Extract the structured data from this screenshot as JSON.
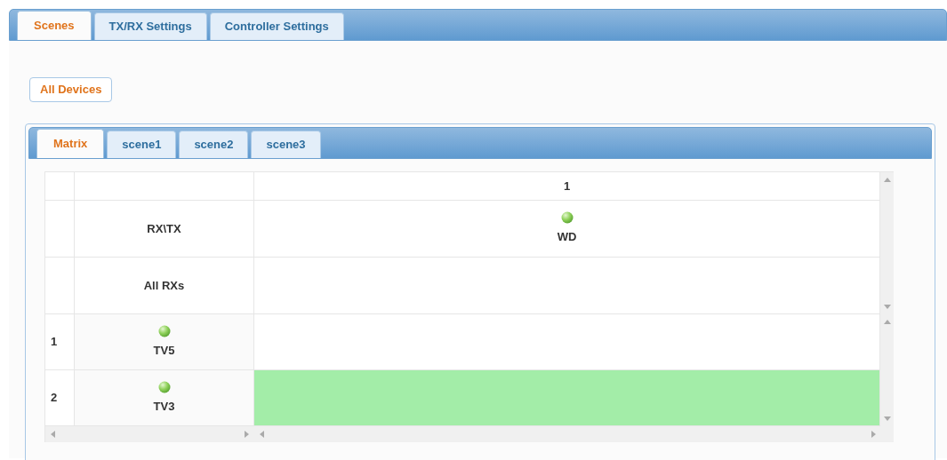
{
  "main_tabs": [
    {
      "label": "Scenes",
      "selected": true
    },
    {
      "label": "TX/RX Settings",
      "selected": false
    },
    {
      "label": "Controller Settings",
      "selected": false
    }
  ],
  "all_devices_button": "All Devices",
  "scene_tabs": [
    {
      "label": "Matrix",
      "selected": true
    },
    {
      "label": "scene1",
      "selected": false
    },
    {
      "label": "scene2",
      "selected": false
    },
    {
      "label": "scene3",
      "selected": false
    }
  ],
  "matrix": {
    "tx_columns": [
      {
        "number": "1",
        "name": "WD",
        "online": true
      }
    ],
    "corner_label": "RX\\TX",
    "all_rx_label": "All RXs",
    "rx_rows": [
      {
        "number": "1",
        "name": "TV5",
        "online": true,
        "cells": [
          {
            "active": false
          }
        ]
      },
      {
        "number": "2",
        "name": "TV3",
        "online": true,
        "cells": [
          {
            "active": true
          }
        ]
      }
    ]
  }
}
